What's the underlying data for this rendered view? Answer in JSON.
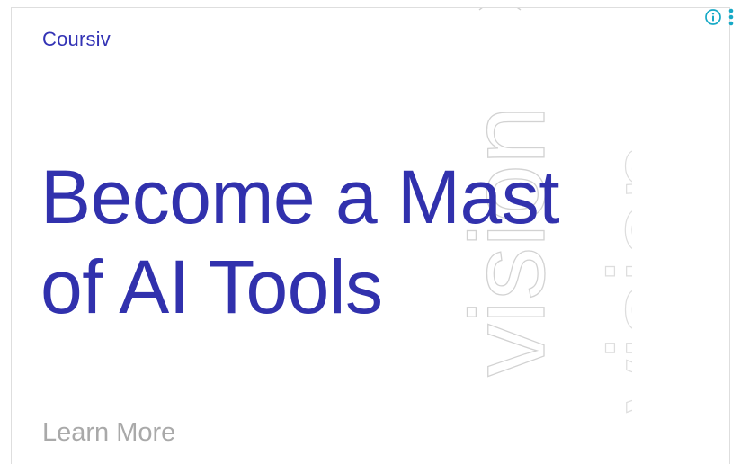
{
  "brand": {
    "name": "Coursiv"
  },
  "headline": {
    "line1": "Become a Mast",
    "line2": "of AI Tools"
  },
  "cta": {
    "label": "Learn More"
  },
  "decoration": {
    "outline_text_1": "vision",
    "outline_text_2": "vision"
  },
  "controls": {
    "info_icon": "info-icon",
    "menu_icon": "kebab-menu-icon"
  },
  "colors": {
    "brand_blue": "#3333b5",
    "cta_gray": "#a9a9a9",
    "icon_teal": "#17a9c6"
  }
}
